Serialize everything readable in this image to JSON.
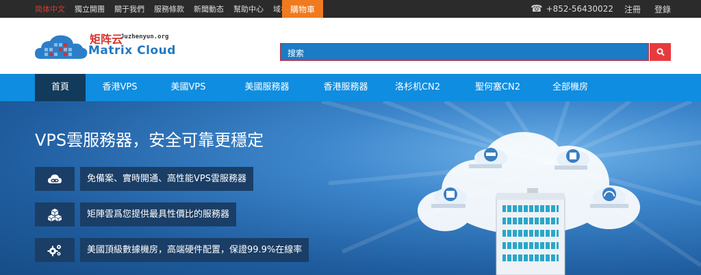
{
  "topbar": {
    "language": "简体中文",
    "links": [
      "獨立開團",
      "關于我們",
      "服務條款",
      "新聞動态",
      "幫助中心",
      "域名注冊"
    ],
    "cart": "購物車",
    "phone": "+852-56430022",
    "register": "注冊",
    "login": "登錄"
  },
  "logo": {
    "cn": "矩阵云",
    "domain": "Juzhenyun.org",
    "en": "Matrix Cloud"
  },
  "search": {
    "placeholder": "搜索"
  },
  "nav": {
    "items": [
      "首頁",
      "香港VPS",
      "美國VPS",
      "美國服務器",
      "香港服務器",
      "洛杉机CN2",
      "聖何塞CN2",
      "全部機房"
    ],
    "active_index": 0
  },
  "banner": {
    "title": "VPS雲服務器，安全可靠更穩定",
    "features": [
      {
        "icon": "cloud-link-icon",
        "text": "免備案、實時開通、高性能VPS雲服務器"
      },
      {
        "icon": "cubes-icon",
        "text": "矩陣雲爲您提供最具性價比的服務器"
      },
      {
        "icon": "gears-icon",
        "text": "美國頂級數據機房，高端硬件配置，保證99.9%在線率"
      }
    ]
  },
  "colors": {
    "accent_orange": "#f07a1e",
    "nav_blue": "#0f8de0",
    "nav_active": "#123a5a",
    "search_red": "#e73a3e",
    "brand_red": "#d6312a"
  }
}
